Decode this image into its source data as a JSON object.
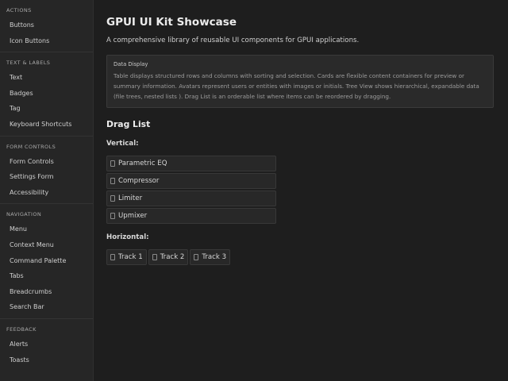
{
  "sidebar": {
    "sections": [
      {
        "title": "ACTIONS",
        "items": [
          "Buttons",
          "Icon Buttons"
        ]
      },
      {
        "title": "TEXT & LABELS",
        "items": [
          "Text",
          "Badges",
          "Tag",
          "Keyboard Shortcuts"
        ]
      },
      {
        "title": "FORM CONTROLS",
        "items": [
          "Form Controls",
          "Settings Form",
          "Accessibility"
        ]
      },
      {
        "title": "NAVIGATION",
        "items": [
          "Menu",
          "Context Menu",
          "Command Palette",
          "Tabs",
          "Breadcrumbs",
          "Search Bar"
        ]
      },
      {
        "title": "FEEDBACK",
        "items": [
          "Alerts",
          "Toasts"
        ]
      }
    ]
  },
  "main": {
    "title": "GPUI UI Kit Showcase",
    "subtitle": "A comprehensive library of reusable UI components for GPUI applications.",
    "info": {
      "title": "Data Display",
      "body": "Table displays structured rows and columns with sorting and selection. Cards are flexible content containers for preview or summary information. Avatars represent users or entities with images or initials. Tree View shows hierarchical, expandable data (file trees, nested lists ). Drag List is an orderable list where items can be reordered by dragging."
    },
    "drag_list": {
      "heading": "Drag List",
      "vertical_label": "Vertical:",
      "vertical_items": [
        "Parametric EQ",
        "Compressor",
        "Limiter",
        "Upmixer"
      ],
      "horizontal_label": "Horizontal:",
      "horizontal_items": [
        "Track 1",
        "Track 2",
        "Track 3"
      ]
    }
  },
  "icons": {
    "drag_handle": "drag-handle-icon"
  }
}
